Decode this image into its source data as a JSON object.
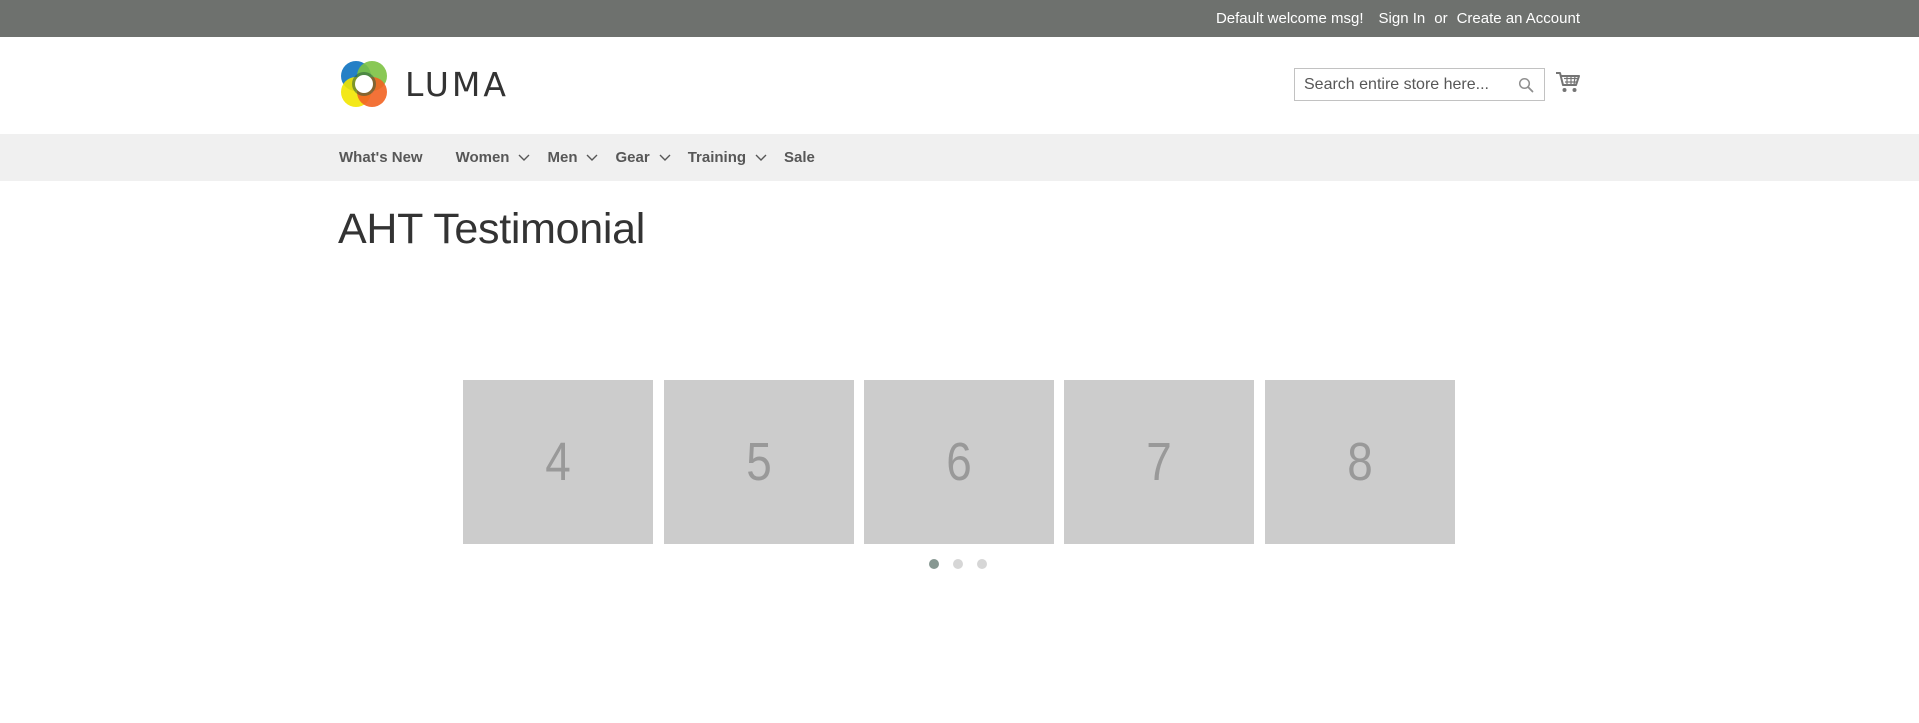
{
  "header_panel": {
    "welcome": "Default welcome msg!",
    "sign_in": "Sign In",
    "or": "or",
    "create_account": "Create an Account",
    "background": "#6e716e"
  },
  "logo": {
    "text": "LUMA",
    "icon": "luma-logo-icon"
  },
  "search": {
    "placeholder": "Search entire store here...",
    "icon": "search-icon"
  },
  "cart": {
    "icon": "cart-icon"
  },
  "nav": {
    "items": [
      {
        "label": "What's New",
        "has_submenu": false
      },
      {
        "label": "Women",
        "has_submenu": true
      },
      {
        "label": "Men",
        "has_submenu": true
      },
      {
        "label": "Gear",
        "has_submenu": true
      },
      {
        "label": "Training",
        "has_submenu": true
      },
      {
        "label": "Sale",
        "has_submenu": false
      }
    ]
  },
  "page": {
    "title": "AHT Testimonial"
  },
  "slider": {
    "slides": [
      "4",
      "5",
      "6",
      "7",
      "8"
    ],
    "slide_color": "#cccccc",
    "dots": 3,
    "active_dot": 1
  }
}
